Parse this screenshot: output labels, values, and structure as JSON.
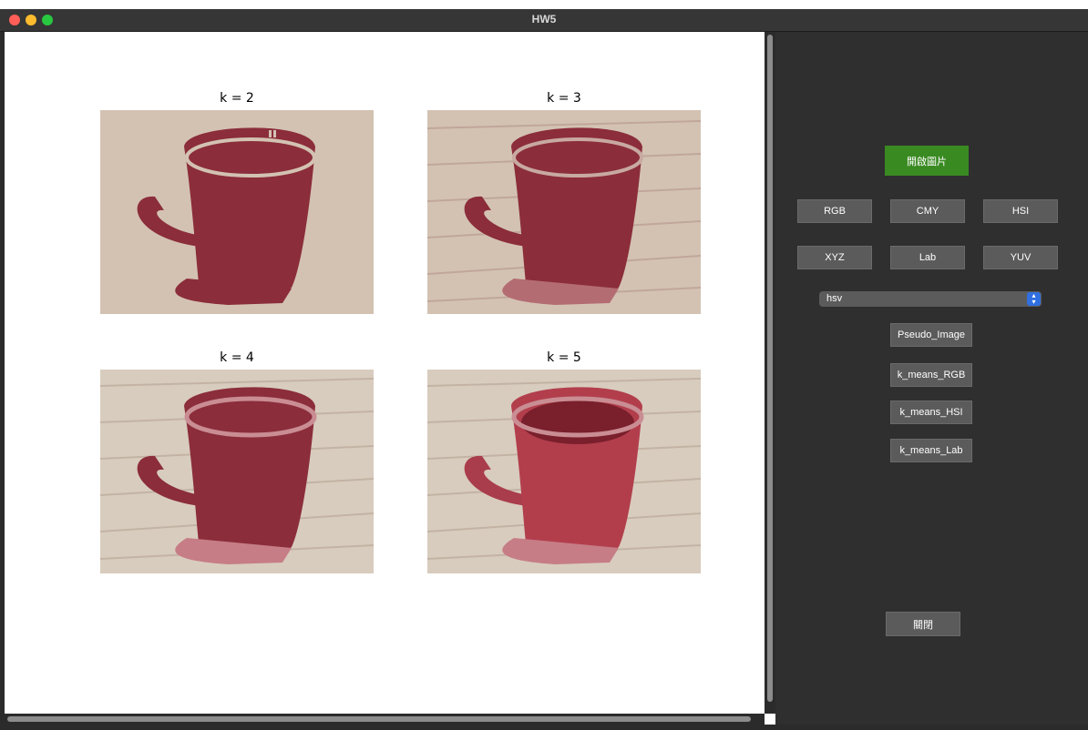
{
  "window": {
    "title": "HW5"
  },
  "results": [
    {
      "label": "k = 2",
      "k": 2
    },
    {
      "label": "k = 3",
      "k": 3
    },
    {
      "label": "k = 4",
      "k": 4
    },
    {
      "label": "k = 5",
      "k": 5
    }
  ],
  "controls": {
    "open_image": "開啟圖片",
    "color_spaces_row1": [
      "RGB",
      "CMY",
      "HSI"
    ],
    "color_spaces_row2": [
      "XYZ",
      "Lab",
      "YUV"
    ],
    "colormap_select": {
      "value": "hsv"
    },
    "pseudo_image": "Pseudo_Image",
    "k_means_rgb": "k_means_RGB",
    "k_means_hsi": "k_means_HSI",
    "k_means_lab": "k_means_Lab",
    "close": "關閉"
  },
  "colors": {
    "accent_green": "#3a8a22",
    "mug_red": "#8b2d3b",
    "background_beige": "#d3c2b2",
    "panel_dark": "#2f2f2f"
  }
}
